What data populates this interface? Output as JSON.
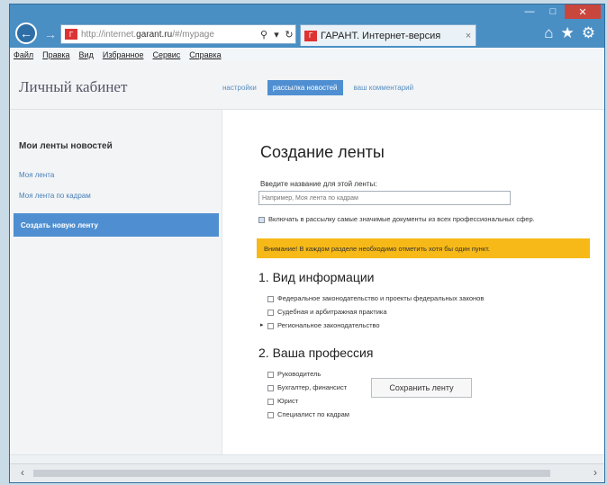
{
  "browser": {
    "address_url_prefix": "http://internet.",
    "address_url_domain": "garant.ru",
    "address_url_suffix": "/#/mypage",
    "search_icon": "magnifier-icon",
    "tab_title": "ГАРАНТ. Интернет-версия",
    "tab_close": "×",
    "fav_label": "Г"
  },
  "menu": [
    "Файл",
    "Правка",
    "Вид",
    "Избранное",
    "Сервис",
    "Справка"
  ],
  "site": {
    "title": "Личный кабинет",
    "nav": [
      "настройки",
      "рассылка новостей",
      "ваш комментарий"
    ],
    "nav_active_index": 1
  },
  "sidebar": {
    "heading": "Мои ленты новостей",
    "links": [
      "Моя лента",
      "Моя лента по кадрам"
    ],
    "active": "Создать новую ленту"
  },
  "form": {
    "title": "Создание ленты",
    "name_label": "Введите название для этой ленты:",
    "name_placeholder": "Например, Моя лента по кадрам",
    "include_text": "Включать в рассылку самые значимые документы из всех профессиональных сфер.",
    "warning": "Внимание! В каждом разделе необходимо отметить хотя бы один пункт.",
    "section1_title": "1. Вид информации",
    "section1_options": [
      "Федеральное законодательство и проекты федеральных законов",
      "Судебная и арбитражная практика",
      "Региональное законодательство"
    ],
    "section2_title": "2. Ваша профессия",
    "section2_options": [
      "Руководитель",
      "Бухгалтер, финансист",
      "Юрист",
      "Специалист по кадрам"
    ],
    "save_label": "Сохранить ленту"
  }
}
